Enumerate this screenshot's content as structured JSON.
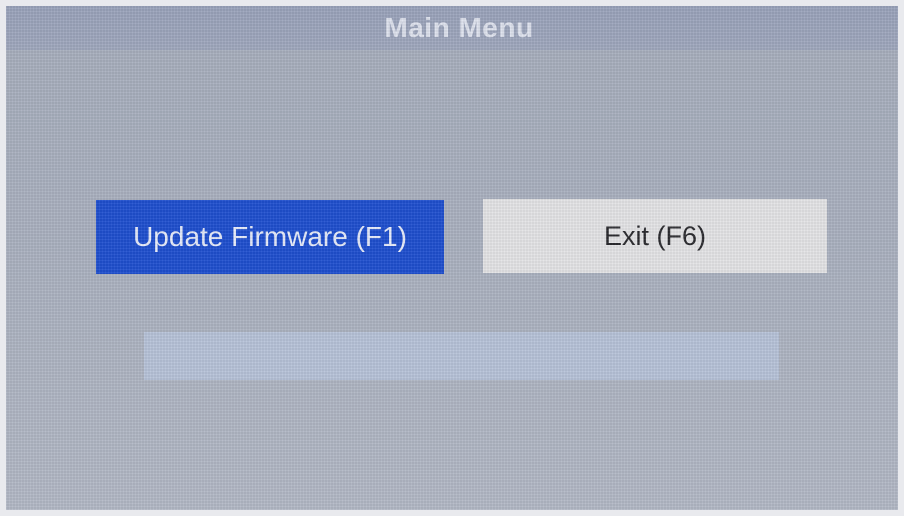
{
  "window": {
    "title": "Main Menu"
  },
  "buttons": {
    "update_label": "Update Firmware (F1)",
    "exit_label": "Exit (F6)"
  },
  "progress": {
    "value": 0
  },
  "colors": {
    "title_bar": "#9aa3bb",
    "background": "#aab1c0",
    "update_button": "#1f4fcf",
    "exit_button": "#e4e4e6",
    "progress_track": "#b7c3d9"
  }
}
